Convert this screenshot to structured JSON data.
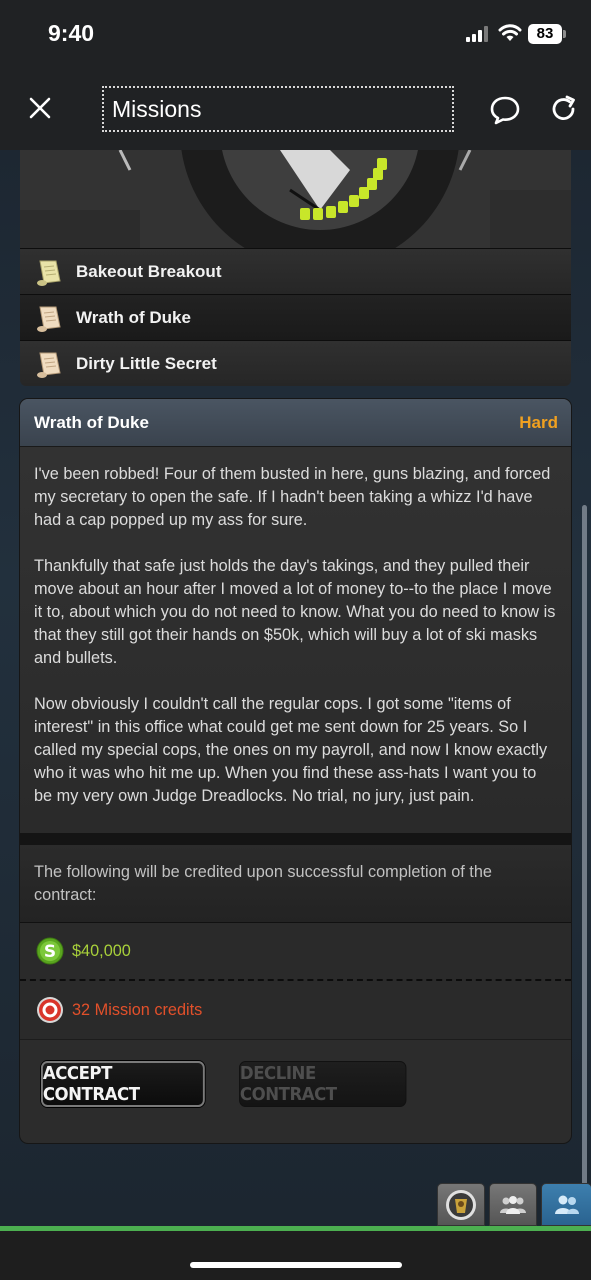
{
  "status_bar": {
    "time": "9:40",
    "battery": "83"
  },
  "nav": {
    "title": "Missions",
    "icons": [
      "close-icon",
      "chat-bubble-icon",
      "reload-icon"
    ]
  },
  "missions": [
    {
      "label": "Bakeout Breakout",
      "icon": "scroll-icon"
    },
    {
      "label": "Wrath of Duke",
      "icon": "scroll-icon"
    },
    {
      "label": "Dirty Little Secret",
      "icon": "scroll-icon"
    }
  ],
  "detail": {
    "title": "Wrath of Duke",
    "difficulty": "Hard",
    "paragraphs": [
      "I've been robbed! Four of them busted in here, guns blazing, and forced my secretary to open the safe. If I hadn't been taking a whizz I'd have had a cap popped up my ass for sure.",
      "Thankfully that safe just holds the day's takings, and they pulled their move about an hour after I moved a lot of money to--to the place I move it to, about which you do not need to know. What you do need to know is that they still got their hands on $50k, which will buy a lot of ski masks and bullets.",
      "Now obviously I couldn't call the regular cops. I got some \"items of interest\" in this office what could get me sent down for 25 years. So I called my special cops, the ones on my payroll, and now I know exactly who it was who hit me up. When you find these ass-hats I want you to be my very own Judge Dreadlocks. No trial, no jury, just pain."
    ],
    "reward_intro": "The following will be credited upon successful completion of the contract:",
    "rewards": {
      "cash": "$40,000",
      "credits": "32 Mission credits"
    },
    "accept_label": "ACCEPT CONTRACT",
    "decline_label": "DECLINE CONTRACT"
  },
  "colors": {
    "difficulty": "#f0a020",
    "cash": "#a8d03a",
    "credits": "#e2502a",
    "accent_line": "#4caf50"
  },
  "dock": [
    "portrait-icon",
    "group-icon",
    "friends-icon"
  ]
}
